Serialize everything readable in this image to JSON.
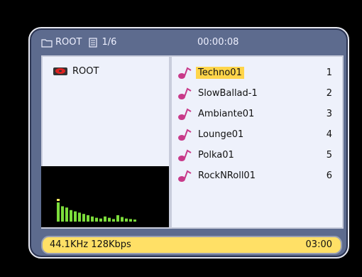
{
  "header": {
    "folder_label": "ROOT",
    "page_label": "1/6",
    "time": "00:00:08"
  },
  "left_panel": {
    "root_label": "ROOT",
    "visualizer_levels": [
      0.75,
      0.6,
      0.55,
      0.45,
      0.4,
      0.35,
      0.3,
      0.25,
      0.2,
      0.15,
      0.12,
      0.2,
      0.15,
      0.1,
      0.25,
      0.18,
      0.12,
      0.1,
      0.08
    ]
  },
  "tracks": [
    {
      "name": "Techno01",
      "index": "1",
      "selected": true
    },
    {
      "name": "SlowBallad-1",
      "index": "2",
      "selected": false
    },
    {
      "name": "Ambiante01",
      "index": "3",
      "selected": false
    },
    {
      "name": "Lounge01",
      "index": "4",
      "selected": false
    },
    {
      "name": "Polka01",
      "index": "5",
      "selected": false
    },
    {
      "name": "RockNRoll01",
      "index": "6",
      "selected": false
    }
  ],
  "status": {
    "info": "44.1KHz  128Kbps",
    "duration": "03:00"
  },
  "colors": {
    "frame": "#5d6b8e",
    "panel": "#eef1fb",
    "highlight": "#ffd54a",
    "status_bg": "#ffe066",
    "viz": "#7bdc3b"
  }
}
